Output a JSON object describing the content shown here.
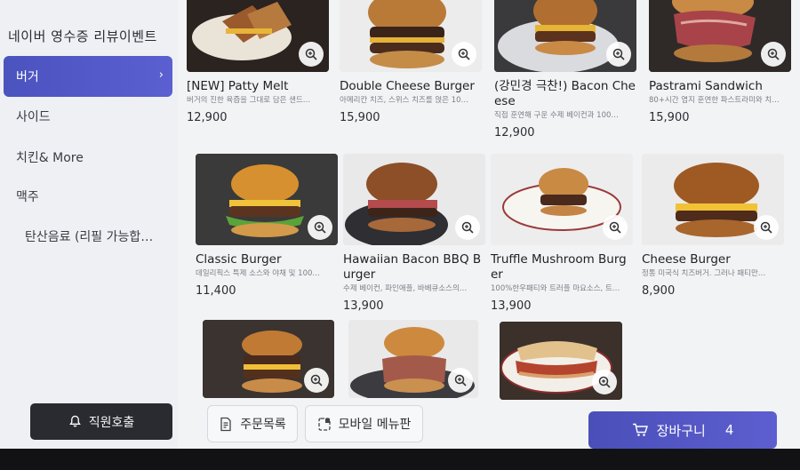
{
  "sidebar": {
    "title": "네이버 영수증 리뷰이벤트",
    "categories": [
      {
        "label": "버거",
        "active": true
      },
      {
        "label": "사이드"
      },
      {
        "label": "치킨& More"
      },
      {
        "label": "맥주"
      },
      {
        "label": "탄산음료 (리필 가능합…"
      }
    ],
    "staff_call": "직원호출"
  },
  "menu": [
    {
      "name": "[NEW] Patty Melt",
      "desc": "버거의 진한 육즙을 그대로 담은 샌드…",
      "price": "12,900"
    },
    {
      "name": "Double Cheese Burger",
      "desc": "아메리칸 치즈, 스위스 치즈를 얹은 10…",
      "price": "15,900"
    },
    {
      "name": "(강민경 극찬!) Bacon Cheese",
      "desc": "직접 훈연해 구운 수제 베이컨과 100…",
      "price": "12,900"
    },
    {
      "name": "Pastrami Sandwich",
      "desc": "80+시간 염지 훈연한 파스트라미와 치…",
      "price": "15,900"
    },
    {
      "name": "Classic Burger",
      "desc": "데일리픽스 특제 소스와 야채 및 100…",
      "price": "11,400"
    },
    {
      "name": "Hawaiian Bacon BBQ Burger",
      "desc": "수제 베이컨, 파인애플, 바베큐소스의…",
      "price": "13,900"
    },
    {
      "name": "Truffle Mushroom Burger",
      "desc": "100%한우패티와 트러플 마요소스, 트…",
      "price": "13,900"
    },
    {
      "name": "Cheese Burger",
      "desc": "정통 미국식 치즈버거. 그러나 패티만…",
      "price": "8,900"
    },
    {
      "name": "",
      "desc": "",
      "price": ""
    },
    {
      "name": "",
      "desc": "",
      "price": ""
    },
    {
      "name": "",
      "desc": "",
      "price": ""
    }
  ],
  "bottom": {
    "order_history": "주문목록",
    "mobile_menu": "모바일 메뉴판",
    "cart_label": "장바구니",
    "cart_count": "4"
  },
  "colors": {
    "accent": "#4f55c4",
    "staff_button": "#2a2b30"
  }
}
